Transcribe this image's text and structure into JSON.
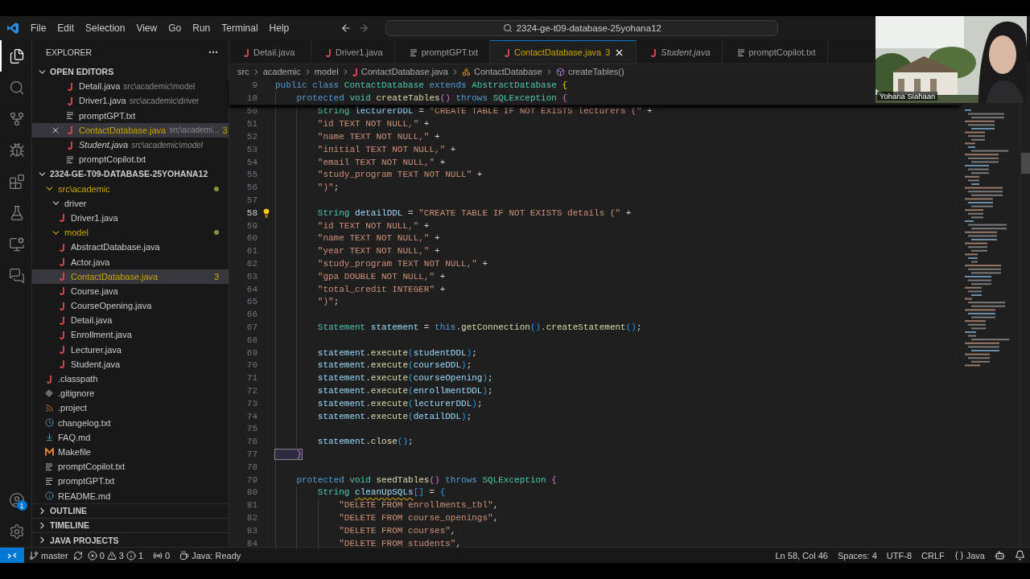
{
  "title_bar": {
    "menu": [
      "File",
      "Edit",
      "Selection",
      "View",
      "Go",
      "Run",
      "Terminal",
      "Help"
    ],
    "search": {
      "value": "2324-ge-t09-database-25yohana12"
    }
  },
  "activity_bar": {
    "items": [
      {
        "kind": "files",
        "selected": true
      },
      {
        "kind": "search",
        "selected": false
      },
      {
        "kind": "source-control",
        "selected": false
      },
      {
        "kind": "run-debug",
        "selected": false
      },
      {
        "kind": "extensions",
        "selected": false
      },
      {
        "kind": "testing",
        "selected": false
      },
      {
        "kind": "remote",
        "selected": false
      },
      {
        "kind": "chat",
        "selected": false
      }
    ],
    "account_badge": "1"
  },
  "sidebar": {
    "title": "EXPLORER",
    "open_editors": {
      "label": "OPEN EDITORS",
      "expanded": true,
      "items": [
        {
          "name": "Detail.java",
          "path": "src\\academic\\model",
          "kind": "java",
          "selected": false,
          "modified": false,
          "preview": false
        },
        {
          "name": "Driver1.java",
          "path": "src\\academic\\driver",
          "kind": "java",
          "selected": false,
          "modified": false,
          "preview": false
        },
        {
          "name": "promptGPT.txt",
          "kind": "txt",
          "selected": false,
          "modified": false,
          "preview": false
        },
        {
          "name": "ContactDatabase.java",
          "path": "src\\academi...",
          "badge": "3",
          "kind": "java",
          "selected": true,
          "modified": true,
          "preview": false
        },
        {
          "name": "Student.java",
          "path": "src\\academic\\model",
          "kind": "java",
          "selected": false,
          "modified": false,
          "preview": true
        },
        {
          "name": "promptCopilot.txt",
          "kind": "txt",
          "selected": false,
          "modified": false,
          "preview": false
        }
      ]
    },
    "project": {
      "label": "2324-GE-T09-DATABASE-25YOHANA12",
      "expanded": true,
      "children": [
        {
          "label": "src\\academic",
          "kind": "folder",
          "expanded": true,
          "modified": true,
          "selected": false,
          "children": [
            {
              "label": "driver",
              "kind": "folder",
              "expanded": true,
              "modified": false,
              "selected": false,
              "children": [
                {
                  "label": "Driver1.java",
                  "kind": "java",
                  "modified": false,
                  "selected": false
                }
              ]
            },
            {
              "label": "model",
              "kind": "folder",
              "expanded": true,
              "modified": true,
              "selected": false,
              "children": [
                {
                  "label": "AbstractDatabase.java",
                  "kind": "java",
                  "modified": false,
                  "selected": false
                },
                {
                  "label": "Actor.java",
                  "kind": "java",
                  "modified": false,
                  "selected": false
                },
                {
                  "label": "ContactDatabase.java",
                  "kind": "java",
                  "modified": true,
                  "selected": true,
                  "badge": "3"
                },
                {
                  "label": "Course.java",
                  "kind": "java",
                  "modified": false,
                  "selected": false
                },
                {
                  "label": "CourseOpening.java",
                  "kind": "java",
                  "modified": false,
                  "selected": false
                },
                {
                  "label": "Detail.java",
                  "kind": "java",
                  "modified": false,
                  "selected": false
                },
                {
                  "label": "Enrollment.java",
                  "kind": "java",
                  "modified": false,
                  "selected": false
                },
                {
                  "label": "Lecturer.java",
                  "kind": "java",
                  "modified": false,
                  "selected": false
                },
                {
                  "label": "Student.java",
                  "kind": "java",
                  "modified": false,
                  "selected": false
                }
              ]
            }
          ]
        },
        {
          "label": ".classpath",
          "kind": "java",
          "modified": false,
          "selected": false
        },
        {
          "label": ".gitignore",
          "kind": "git",
          "modified": false,
          "selected": false
        },
        {
          "label": ".project",
          "kind": "feed",
          "modified": false,
          "selected": false
        },
        {
          "label": "changelog.txt",
          "kind": "changelog",
          "modified": false,
          "selected": false
        },
        {
          "label": "FAQ.md",
          "kind": "markdown",
          "modified": false,
          "selected": false
        },
        {
          "label": "Makefile",
          "kind": "makefile",
          "modified": false,
          "selected": false
        },
        {
          "label": "promptCopilot.txt",
          "kind": "txt",
          "modified": false,
          "selected": false
        },
        {
          "label": "promptGPT.txt",
          "kind": "txt",
          "modified": false,
          "selected": false
        },
        {
          "label": "README.md",
          "kind": "readme",
          "modified": false,
          "selected": false
        }
      ]
    },
    "sections": [
      {
        "label": "OUTLINE",
        "expanded": false
      },
      {
        "label": "TIMELINE",
        "expanded": false
      },
      {
        "label": "JAVA PROJECTS",
        "expanded": false
      }
    ]
  },
  "tabs": [
    {
      "label": "Detail.java",
      "kind": "java",
      "selected": false,
      "modified": false,
      "preview": false
    },
    {
      "label": "Driver1.java",
      "kind": "java",
      "selected": false,
      "modified": false,
      "preview": false
    },
    {
      "label": "promptGPT.txt",
      "kind": "txt",
      "selected": false,
      "modified": false,
      "preview": false
    },
    {
      "label": "ContactDatabase.java",
      "kind": "java",
      "selected": true,
      "modified": true,
      "preview": false,
      "badge": "3"
    },
    {
      "label": "Student.java",
      "kind": "java",
      "selected": false,
      "modified": false,
      "preview": true
    },
    {
      "label": "promptCopilot.txt",
      "kind": "txt",
      "selected": false,
      "modified": false,
      "preview": false
    }
  ],
  "breadcrumb": [
    {
      "label": "src",
      "kind": "folder"
    },
    {
      "label": "academic",
      "kind": "folder"
    },
    {
      "label": "model",
      "kind": "folder"
    },
    {
      "label": "ContactDatabase.java",
      "kind": "java"
    },
    {
      "label": "ContactDatabase",
      "kind": "class"
    },
    {
      "label": "createTables()",
      "kind": "method"
    }
  ],
  "editor": {
    "sticky": [
      {
        "no": "9",
        "current": false,
        "tokens": [
          {
            "kind": "kw",
            "text": "public class "
          },
          {
            "kind": "type",
            "text": "ContactDatabase "
          },
          {
            "kind": "kw",
            "text": "extends "
          },
          {
            "kind": "type",
            "text": "AbstractDatabase "
          },
          {
            "kind": "b1",
            "text": "{"
          }
        ]
      },
      {
        "no": "18",
        "current": false,
        "tokens": [
          {
            "kind": "kw",
            "text": "    protected "
          },
          {
            "kind": "type",
            "text": "void "
          },
          {
            "kind": "fn",
            "text": "createTables"
          },
          {
            "kind": "b2",
            "text": "()"
          },
          {
            "kind": "kw",
            "text": " throws "
          },
          {
            "kind": "type",
            "text": "SQLException "
          },
          {
            "kind": "b2",
            "text": "{"
          }
        ]
      }
    ],
    "lines": [
      {
        "no": "50",
        "current": false,
        "tokens": [
          {
            "kind": "type",
            "text": "        String "
          },
          {
            "kind": "var",
            "text": "lecturerDDL "
          },
          {
            "kind": "op",
            "text": "= "
          },
          {
            "kind": "str",
            "text": "\"CREATE TABLE IF NOT EXISTS lecturers (\""
          },
          {
            "kind": "op",
            "text": " +"
          }
        ]
      },
      {
        "no": "51",
        "current": false,
        "tokens": [
          {
            "kind": "str",
            "text": "        \"id TEXT NOT NULL,\""
          },
          {
            "kind": "op",
            "text": " +"
          }
        ]
      },
      {
        "no": "52",
        "current": false,
        "tokens": [
          {
            "kind": "str",
            "text": "        \"name TEXT NOT NULL,\""
          },
          {
            "kind": "op",
            "text": " +"
          }
        ]
      },
      {
        "no": "53",
        "current": false,
        "tokens": [
          {
            "kind": "str",
            "text": "        \"initial TEXT NOT NULL,\""
          },
          {
            "kind": "op",
            "text": " +"
          }
        ]
      },
      {
        "no": "54",
        "current": false,
        "tokens": [
          {
            "kind": "str",
            "text": "        \"email TEXT NOT NULL,\""
          },
          {
            "kind": "op",
            "text": " +"
          }
        ]
      },
      {
        "no": "55",
        "current": false,
        "tokens": [
          {
            "kind": "str",
            "text": "        \"study_program TEXT NOT NULL\""
          },
          {
            "kind": "op",
            "text": " +"
          }
        ]
      },
      {
        "no": "56",
        "current": false,
        "tokens": [
          {
            "kind": "str",
            "text": "        \")\""
          },
          {
            "kind": "op",
            "text": ";"
          }
        ]
      },
      {
        "no": "57",
        "current": false
      },
      {
        "no": "58",
        "current": true,
        "tokens": [
          {
            "kind": "type",
            "text": "        String "
          },
          {
            "kind": "var",
            "text": "detailDDL "
          },
          {
            "kind": "op",
            "text": "= "
          },
          {
            "kind": "str",
            "text": "\"CREATE TABLE IF NOT EXISTS details (\""
          },
          {
            "kind": "op",
            "text": " +"
          }
        ]
      },
      {
        "no": "59",
        "current": false,
        "tokens": [
          {
            "kind": "str",
            "text": "        \"id TEXT NOT NULL,\""
          },
          {
            "kind": "op",
            "text": " +"
          }
        ]
      },
      {
        "no": "60",
        "current": false,
        "tokens": [
          {
            "kind": "str",
            "text": "        \"name TEXT NOT NULL,\""
          },
          {
            "kind": "op",
            "text": " +"
          }
        ]
      },
      {
        "no": "61",
        "current": false,
        "tokens": [
          {
            "kind": "str",
            "text": "        \"year TEXT NOT NULL,\""
          },
          {
            "kind": "op",
            "text": " +"
          }
        ]
      },
      {
        "no": "62",
        "current": false,
        "tokens": [
          {
            "kind": "str",
            "text": "        \"study_program TEXT NOT NULL,\""
          },
          {
            "kind": "op",
            "text": " +"
          }
        ]
      },
      {
        "no": "63",
        "current": false,
        "tokens": [
          {
            "kind": "str",
            "text": "        \"gpa DOUBLE NOT NULL,\""
          },
          {
            "kind": "op",
            "text": " +"
          }
        ]
      },
      {
        "no": "64",
        "current": false,
        "tokens": [
          {
            "kind": "str",
            "text": "        \"total_credit INTEGER\""
          },
          {
            "kind": "op",
            "text": " +"
          }
        ]
      },
      {
        "no": "65",
        "current": false,
        "tokens": [
          {
            "kind": "str",
            "text": "        \")\""
          },
          {
            "kind": "op",
            "text": ";"
          }
        ]
      },
      {
        "no": "66",
        "current": false
      },
      {
        "no": "67",
        "current": false,
        "tokens": [
          {
            "kind": "type",
            "text": "        Statement "
          },
          {
            "kind": "var",
            "text": "statement "
          },
          {
            "kind": "op",
            "text": "= "
          },
          {
            "kind": "kw",
            "text": "this"
          },
          {
            "kind": "op",
            "text": "."
          },
          {
            "kind": "fn",
            "text": "getConnection"
          },
          {
            "kind": "b3",
            "text": "()"
          },
          {
            "kind": "op",
            "text": "."
          },
          {
            "kind": "fn",
            "text": "createStatement"
          },
          {
            "kind": "b3",
            "text": "()"
          },
          {
            "kind": "op",
            "text": ";"
          }
        ]
      },
      {
        "no": "68",
        "current": false
      },
      {
        "no": "69",
        "current": false,
        "tokens": [
          {
            "kind": "var",
            "text": "        statement"
          },
          {
            "kind": "op",
            "text": "."
          },
          {
            "kind": "fn",
            "text": "execute"
          },
          {
            "kind": "b3",
            "text": "("
          },
          {
            "kind": "var",
            "text": "studentDDL"
          },
          {
            "kind": "b3",
            "text": ")"
          },
          {
            "kind": "op",
            "text": ";"
          }
        ]
      },
      {
        "no": "70",
        "current": false,
        "tokens": [
          {
            "kind": "var",
            "text": "        statement"
          },
          {
            "kind": "op",
            "text": "."
          },
          {
            "kind": "fn",
            "text": "execute"
          },
          {
            "kind": "b3",
            "text": "("
          },
          {
            "kind": "var",
            "text": "courseDDL"
          },
          {
            "kind": "b3",
            "text": ")"
          },
          {
            "kind": "op",
            "text": ";"
          }
        ]
      },
      {
        "no": "71",
        "current": false,
        "tokens": [
          {
            "kind": "var",
            "text": "        statement"
          },
          {
            "kind": "op",
            "text": "."
          },
          {
            "kind": "fn",
            "text": "execute"
          },
          {
            "kind": "b3",
            "text": "("
          },
          {
            "kind": "var",
            "text": "courseOpening"
          },
          {
            "kind": "b3",
            "text": ")"
          },
          {
            "kind": "op",
            "text": ";"
          }
        ]
      },
      {
        "no": "72",
        "current": false,
        "tokens": [
          {
            "kind": "var",
            "text": "        statement"
          },
          {
            "kind": "op",
            "text": "."
          },
          {
            "kind": "fn",
            "text": "execute"
          },
          {
            "kind": "b3",
            "text": "("
          },
          {
            "kind": "var",
            "text": "enrollmentDDL"
          },
          {
            "kind": "b3",
            "text": ")"
          },
          {
            "kind": "op",
            "text": ";"
          }
        ]
      },
      {
        "no": "73",
        "current": false,
        "tokens": [
          {
            "kind": "var",
            "text": "        statement"
          },
          {
            "kind": "op",
            "text": "."
          },
          {
            "kind": "fn",
            "text": "execute"
          },
          {
            "kind": "b3",
            "text": "("
          },
          {
            "kind": "var",
            "text": "lecturerDDL"
          },
          {
            "kind": "b3",
            "text": ")"
          },
          {
            "kind": "op",
            "text": ";"
          }
        ]
      },
      {
        "no": "74",
        "current": false,
        "tokens": [
          {
            "kind": "var",
            "text": "        statement"
          },
          {
            "kind": "op",
            "text": "."
          },
          {
            "kind": "fn",
            "text": "execute"
          },
          {
            "kind": "b3",
            "text": "("
          },
          {
            "kind": "var",
            "text": "detailDDL"
          },
          {
            "kind": "b3",
            "text": ")"
          },
          {
            "kind": "op",
            "text": ";"
          }
        ]
      },
      {
        "no": "75",
        "current": false
      },
      {
        "no": "76",
        "current": false,
        "tokens": [
          {
            "kind": "var",
            "text": "        statement"
          },
          {
            "kind": "op",
            "text": "."
          },
          {
            "kind": "fn",
            "text": "close"
          },
          {
            "kind": "b3",
            "text": "()"
          },
          {
            "kind": "op",
            "text": ";"
          }
        ]
      },
      {
        "no": "77",
        "current": false,
        "tokens": [
          {
            "kind": "match",
            "text": "    }"
          }
        ]
      },
      {
        "no": "78",
        "current": false
      },
      {
        "no": "79",
        "current": false,
        "tokens": [
          {
            "kind": "kw",
            "text": "    protected "
          },
          {
            "kind": "type",
            "text": "void "
          },
          {
            "kind": "fn",
            "text": "seedTables"
          },
          {
            "kind": "b2",
            "text": "()"
          },
          {
            "kind": "kw",
            "text": " throws "
          },
          {
            "kind": "type",
            "text": "SQLException "
          },
          {
            "kind": "b2",
            "text": "{"
          }
        ]
      },
      {
        "no": "80",
        "current": false,
        "tokens": [
          {
            "kind": "type",
            "text": "        String "
          },
          {
            "kind": "warn",
            "text": "cleanUpSQLs"
          },
          {
            "kind": "b3",
            "text": "[]"
          },
          {
            "kind": "op",
            "text": " = "
          },
          {
            "kind": "b3",
            "text": "{"
          }
        ]
      },
      {
        "no": "81",
        "current": false,
        "tokens": [
          {
            "kind": "str",
            "text": "            \"DELETE FROM enrollments_tbl\""
          },
          {
            "kind": "op",
            "text": ","
          }
        ]
      },
      {
        "no": "82",
        "current": false,
        "tokens": [
          {
            "kind": "str",
            "text": "            \"DELETE FROM course_openings\""
          },
          {
            "kind": "op",
            "text": ","
          }
        ]
      },
      {
        "no": "83",
        "current": false,
        "tokens": [
          {
            "kind": "str",
            "text": "            \"DELETE FROM courses\""
          },
          {
            "kind": "op",
            "text": ","
          }
        ]
      },
      {
        "no": "84",
        "current": false,
        "tokens": [
          {
            "kind": "str",
            "text": "            \"DELETE FROM students\""
          },
          {
            "kind": "op",
            "text": ","
          }
        ]
      }
    ]
  },
  "webcam": {
    "name": "Yohana Siahaan"
  },
  "status_bar": {
    "branch": "master",
    "errors": "0",
    "warnings": "3",
    "infos": "1",
    "ports": "0",
    "java": "Java: Ready",
    "position": "Ln 58, Col 46",
    "spaces": "Spaces: 4",
    "encoding": "UTF-8",
    "eol": "CRLF",
    "language": "Java"
  }
}
